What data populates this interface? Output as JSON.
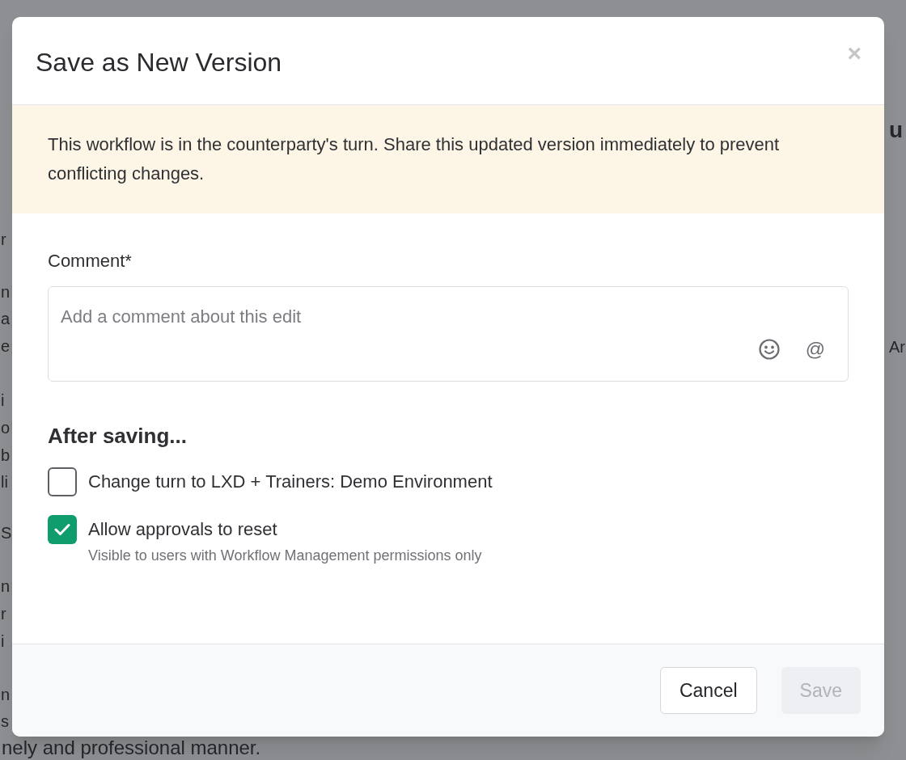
{
  "background_text": {
    "left_lines": [
      "r",
      "n",
      "a",
      "e",
      "i",
      "o",
      "b",
      "li",
      "S",
      "n",
      "r",
      "i",
      "n",
      "s",
      "nely and professional manner."
    ],
    "right_lines": [
      "u",
      "Ar"
    ]
  },
  "dialog": {
    "title": "Save as New Version",
    "close": "×",
    "alert": "This workflow is in the counterparty's turn. Share this updated version immediately to prevent conflicting changes.",
    "comment": {
      "label": "Comment*",
      "placeholder": "Add a comment about this edit",
      "mention": "@"
    },
    "after_saving": {
      "heading": "After saving...",
      "options": [
        {
          "label": "Change turn to LXD + Trainers: Demo Environment",
          "checked": false
        },
        {
          "label": "Allow approvals to reset",
          "checked": true,
          "hint": "Visible to users with Workflow Management permissions only"
        }
      ]
    },
    "buttons": [
      {
        "label": "Cancel",
        "disabled": false
      },
      {
        "label": "Save",
        "disabled": true
      }
    ]
  }
}
